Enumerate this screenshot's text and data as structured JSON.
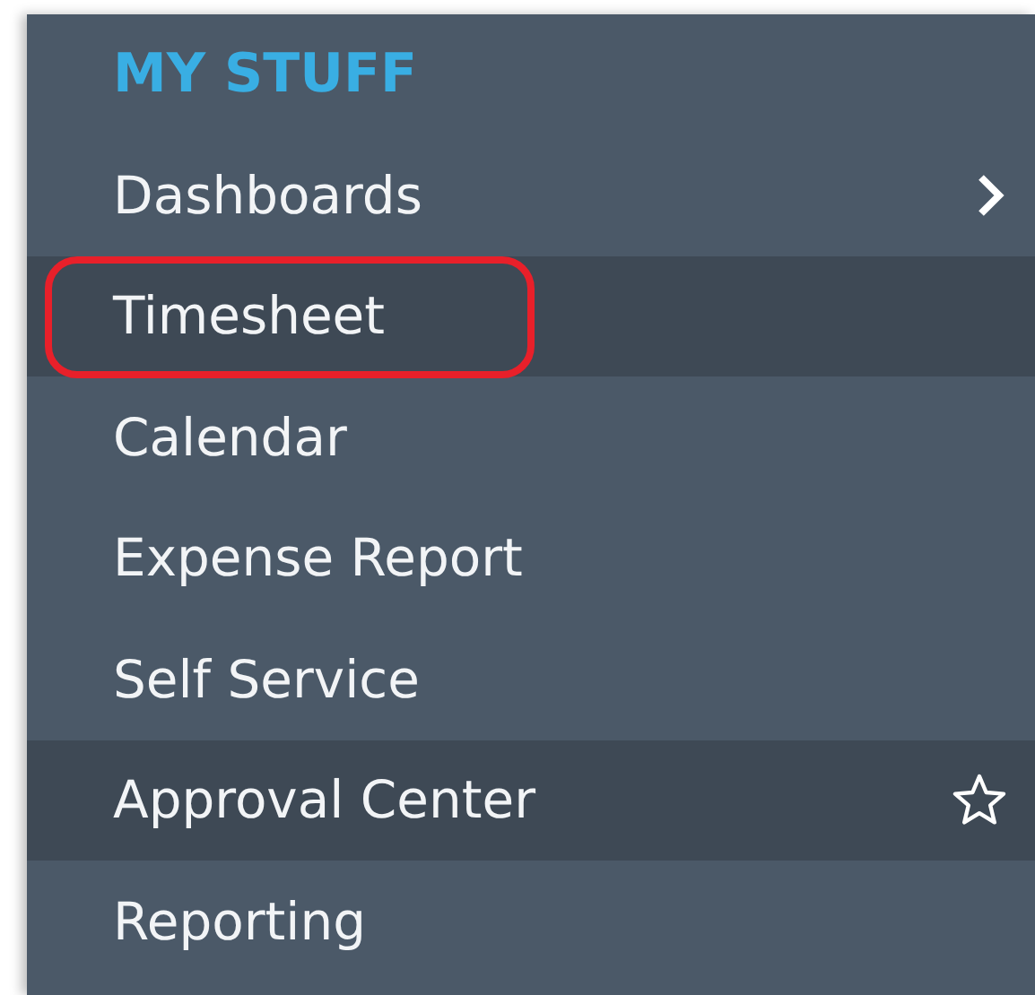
{
  "menu": {
    "heading": "MY STUFF",
    "items": [
      {
        "label": "Dashboards",
        "highlighted": false,
        "annotated": false,
        "kind": "submenu"
      },
      {
        "label": "Timesheet",
        "highlighted": true,
        "annotated": true,
        "kind": "plain"
      },
      {
        "label": "Calendar",
        "highlighted": false,
        "annotated": false,
        "kind": "plain"
      },
      {
        "label": "Expense Report",
        "highlighted": false,
        "annotated": false,
        "kind": "plain"
      },
      {
        "label": "Self Service",
        "highlighted": false,
        "annotated": false,
        "kind": "plain"
      },
      {
        "label": "Approval Center",
        "highlighted": true,
        "annotated": false,
        "kind": "favorite"
      },
      {
        "label": "Reporting",
        "highlighted": false,
        "annotated": false,
        "kind": "plain"
      }
    ]
  }
}
